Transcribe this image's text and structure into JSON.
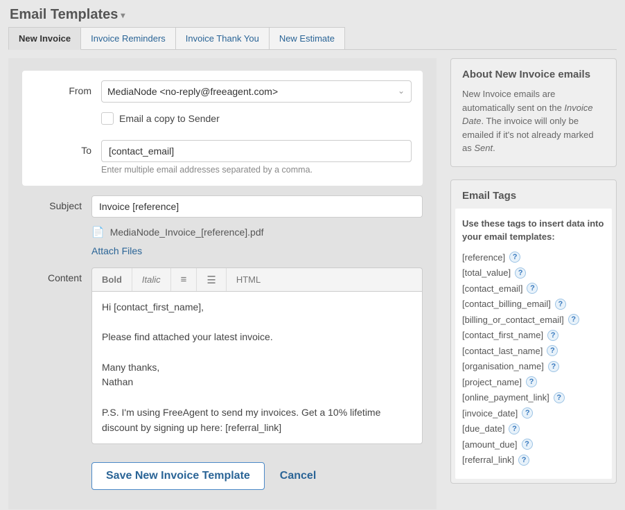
{
  "page": {
    "title": "Email Templates"
  },
  "tabs": [
    {
      "label": "New Invoice",
      "active": true
    },
    {
      "label": "Invoice Reminders",
      "active": false
    },
    {
      "label": "Invoice Thank You",
      "active": false
    },
    {
      "label": "New Estimate",
      "active": false
    }
  ],
  "form": {
    "labels": {
      "from": "From",
      "to": "To",
      "subject": "Subject",
      "content": "Content"
    },
    "from_value": "MediaNode <no-reply@freeagent.com>",
    "email_copy_label": "Email a copy to Sender",
    "to_value": "[contact_email]",
    "to_hint": "Enter multiple email addresses separated by a comma.",
    "subject_value": "Invoice [reference]",
    "attachment_name": "MediaNode_Invoice_[reference].pdf",
    "attach_files_label": "Attach Files",
    "toolbar": {
      "bold": "Bold",
      "italic": "Italic",
      "html": "HTML"
    },
    "content_body": "Hi [contact_first_name],\n\nPlease find attached your latest invoice.\n\nMany thanks,\nNathan\n\nP.S. I'm using FreeAgent to send my invoices. Get a 10% lifetime discount by signing up here: [referral_link]",
    "save_label": "Save New Invoice Template",
    "cancel_label": "Cancel"
  },
  "about": {
    "title": "About New Invoice emails",
    "text_pre": "New Invoice emails are automatically sent on the ",
    "text_em1": "Invoice Date",
    "text_mid": ". The invoice will only be emailed if it's not already marked as ",
    "text_em2": "Sent",
    "text_post": "."
  },
  "tags_box": {
    "title": "Email Tags",
    "intro": "Use these tags to insert data into your email templates:",
    "list": [
      "[reference]",
      "[total_value]",
      "[contact_email]",
      "[contact_billing_email]",
      "[billing_or_contact_email]",
      "[contact_first_name]",
      "[contact_last_name]",
      "[organisation_name]",
      "[project_name]",
      "[online_payment_link]",
      "[invoice_date]",
      "[due_date]",
      "[amount_due]",
      "[referral_link]"
    ]
  }
}
